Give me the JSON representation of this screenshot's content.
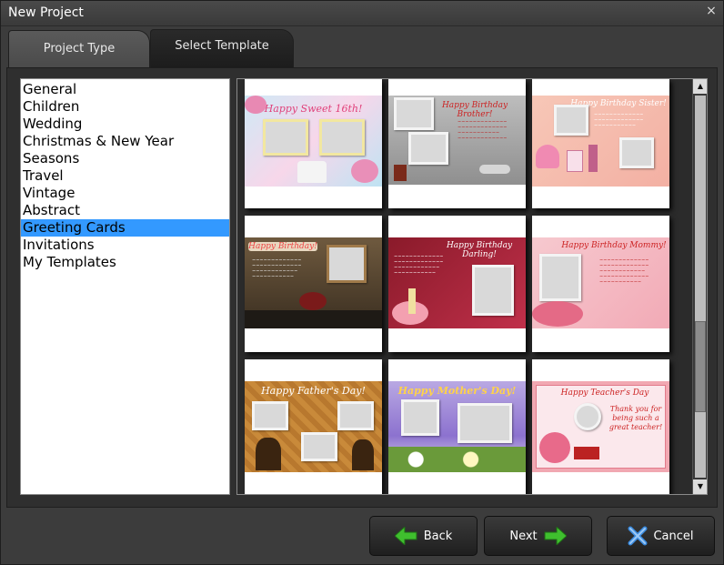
{
  "window": {
    "title": "New Project",
    "close_glyph": "×"
  },
  "tabs": [
    {
      "label": "Project Type",
      "active": false
    },
    {
      "label": "Select Template",
      "active": true
    }
  ],
  "categories": [
    {
      "label": "General"
    },
    {
      "label": "Children"
    },
    {
      "label": "Wedding"
    },
    {
      "label": "Christmas & New Year"
    },
    {
      "label": "Seasons"
    },
    {
      "label": "Travel"
    },
    {
      "label": "Vintage"
    },
    {
      "label": "Abstract"
    },
    {
      "label": "Greeting Cards",
      "selected": true
    },
    {
      "label": "Invitations"
    },
    {
      "label": "My Templates"
    }
  ],
  "templates": [
    {
      "caption": "Happy Sweet 16th!"
    },
    {
      "caption": "Happy Birthday Brother!"
    },
    {
      "caption": "Happy Birthday Sister!"
    },
    {
      "caption": "Happy Birthday!"
    },
    {
      "caption": "Happy Birthday Darling!"
    },
    {
      "caption": "Happy Birthday Mommy!"
    },
    {
      "caption": "Happy Father's Day!"
    },
    {
      "caption": "Happy Mother's Day!"
    },
    {
      "caption": "Happy Teacher's Day",
      "subcaption": "Thank you for being such a great teacher!"
    }
  ],
  "buttons": {
    "back": "Back",
    "next": "Next",
    "cancel": "Cancel"
  },
  "scroll": {
    "position": 0.85
  },
  "colors": {
    "selection": "#3399ff",
    "arrow_green": "#3fbf2e",
    "cancel_blue": "#3a8be0"
  },
  "icons": {
    "back": "arrow-left-icon",
    "next": "arrow-right-icon",
    "cancel": "x-icon",
    "close": "close-icon"
  }
}
